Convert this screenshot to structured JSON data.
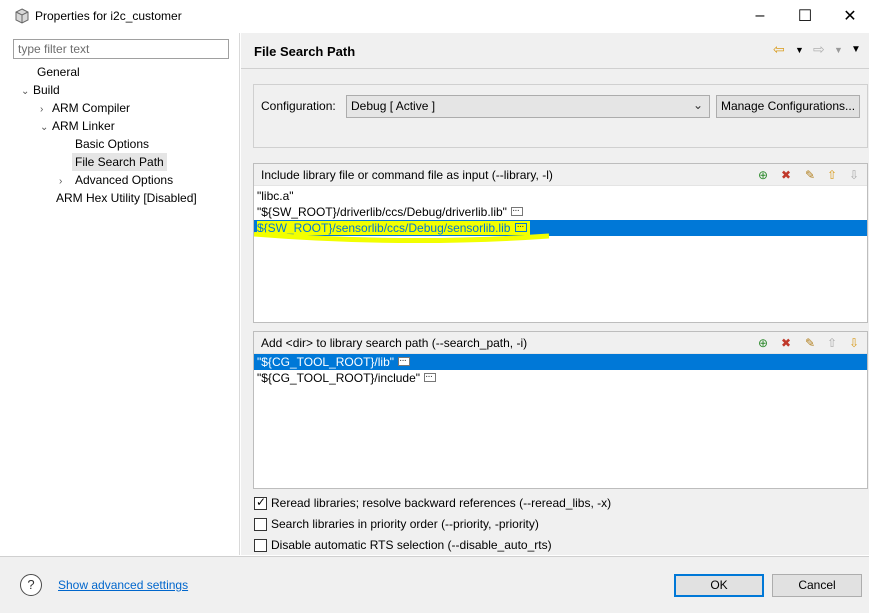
{
  "window": {
    "title": "Properties for i2c_customer",
    "minimize": "–",
    "maximize": "☐",
    "close": "✕"
  },
  "filter": {
    "placeholder": "type filter text"
  },
  "tree": [
    {
      "label": "General"
    },
    {
      "label": "Build"
    },
    {
      "label": "ARM Compiler"
    },
    {
      "label": "ARM Linker"
    },
    {
      "label": "Basic Options"
    },
    {
      "label": "File Search Path"
    },
    {
      "label": "Advanced Options"
    },
    {
      "label": "ARM Hex Utility  [Disabled]"
    }
  ],
  "page": {
    "title": "File Search Path",
    "config_label": "Configuration:",
    "config_value": "Debug  [ Active ]",
    "manage_button": "Manage Configurations..."
  },
  "library_panel": {
    "title": "Include library file or command file as input (--library, -l)",
    "items": [
      "\"libc.a\"",
      "\"${SW_ROOT}/driverlib/ccs/Debug/driverlib.lib\"",
      "${SW_ROOT}/sensorlib/ccs/Debug/sensorlib.lib"
    ]
  },
  "search_panel": {
    "title": "Add <dir> to library search path (--search_path, -i)",
    "items": [
      "\"${CG_TOOL_ROOT}/lib\"",
      "\"${CG_TOOL_ROOT}/include\""
    ]
  },
  "options": [
    {
      "label": "Reread libraries; resolve backward references (--reread_libs, -x)",
      "checked": true
    },
    {
      "label": "Search libraries in priority order (--priority, -priority)",
      "checked": false
    },
    {
      "label": "Disable automatic RTS selection (--disable_auto_rts)",
      "checked": false
    }
  ],
  "footer": {
    "help": "?",
    "advanced_link": "Show advanced settings",
    "ok": "OK",
    "cancel": "Cancel"
  },
  "colors": {
    "selection": "#0078d7",
    "highlight": "#f2ff00",
    "link": "#0066cc"
  },
  "icons": {
    "app": "cube-icon",
    "back": "back-arrow-icon",
    "forward": "forward-arrow-icon",
    "add": "add-icon",
    "delete": "delete-icon",
    "edit": "edit-icon",
    "move_up": "move-up-icon",
    "move_down": "move-down-icon"
  }
}
